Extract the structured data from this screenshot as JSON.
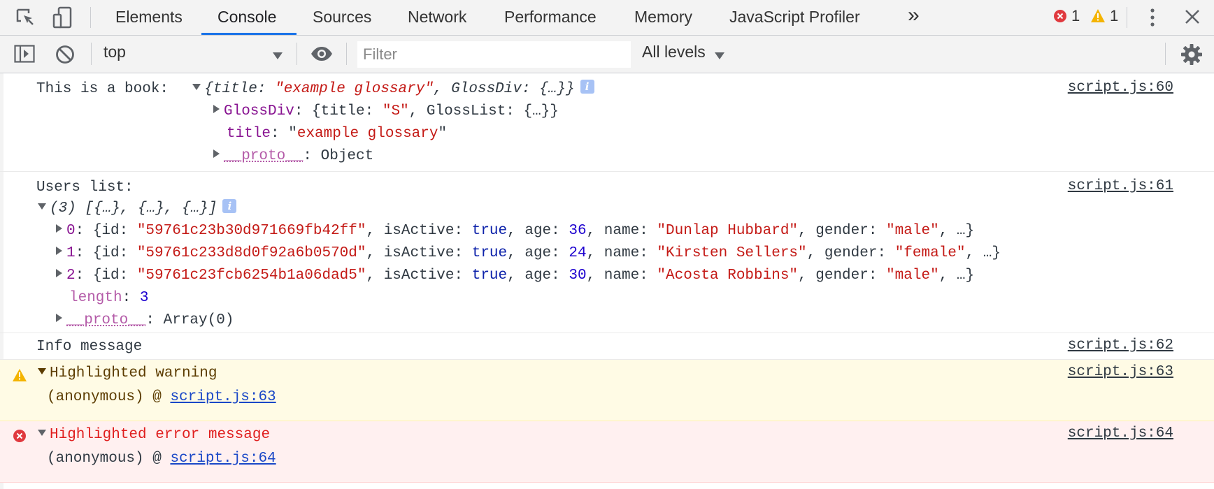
{
  "tabs": {
    "elements": "Elements",
    "console": "Console",
    "sources": "Sources",
    "network": "Network",
    "performance": "Performance",
    "memory": "Memory",
    "profiler": "JavaScript Profiler",
    "more": "»"
  },
  "counts": {
    "errors": "1",
    "warnings": "1"
  },
  "toolbar": {
    "context": "top",
    "filter_placeholder": "Filter",
    "levels": "All levels"
  },
  "messages": {
    "book": {
      "label": "This is a book:  ",
      "summary_pre": "{",
      "summary_k1": "title",
      "summary_colon1": ": ",
      "summary_v1": "\"example glossary\"",
      "summary_comma": ", ",
      "summary_k2": "GlossDiv",
      "summary_colon2": ": ",
      "summary_v2": "{…}",
      "summary_post": "}",
      "glossdiv_key": "GlossDiv",
      "glossdiv_rest_a": ": {title: ",
      "glossdiv_rest_s": "\"S\"",
      "glossdiv_rest_b": ", GlossList: {…}}",
      "title_key": "title",
      "title_colon": ": ",
      "title_value_q1": "\"",
      "title_value": "example glossary",
      "title_value_q2": "\"",
      "proto_key": "__proto__",
      "proto_value": ": Object",
      "source": "script.js:60"
    },
    "users": {
      "label": "Users list:",
      "summary": "(3) [{…}, {…}, {…}]",
      "rows": [
        {
          "idx": "0",
          "id": "\"59761c23b30d971669fb42ff\"",
          "age": "36",
          "name": "\"Dunlap Hubbard\"",
          "gender": "\"male\""
        },
        {
          "idx": "1",
          "id": "\"59761c233d8d0f92a6b0570d\"",
          "age": "24",
          "name": "\"Kirsten Sellers\"",
          "gender": "\"female\""
        },
        {
          "idx": "2",
          "id": "\"59761c23fcb6254b1a06dad5\"",
          "age": "30",
          "name": "\"Acosta Robbins\"",
          "gender": "\"male\""
        }
      ],
      "kv": {
        "colon_open": ": {id: ",
        "isActive": ", isActive: ",
        "true": "true",
        "age": ", age: ",
        "name": ", name: ",
        "gender": ", gender: ",
        "tail": ", …}"
      },
      "length_key": "length",
      "length_colon": ": ",
      "length_value": "3",
      "proto_key": "__proto__",
      "proto_value": ": Array(0)",
      "source": "script.js:61"
    },
    "info": {
      "text": "Info message",
      "source": "script.js:62"
    },
    "warning": {
      "text": "Highlighted warning",
      "trace_prefix": "(anonymous) @ ",
      "trace_link": "script.js:63",
      "source": "script.js:63"
    },
    "error": {
      "text": "Highlighted error message",
      "trace_prefix": "(anonymous) @ ",
      "trace_link": "script.js:64",
      "source": "script.js:64"
    }
  }
}
